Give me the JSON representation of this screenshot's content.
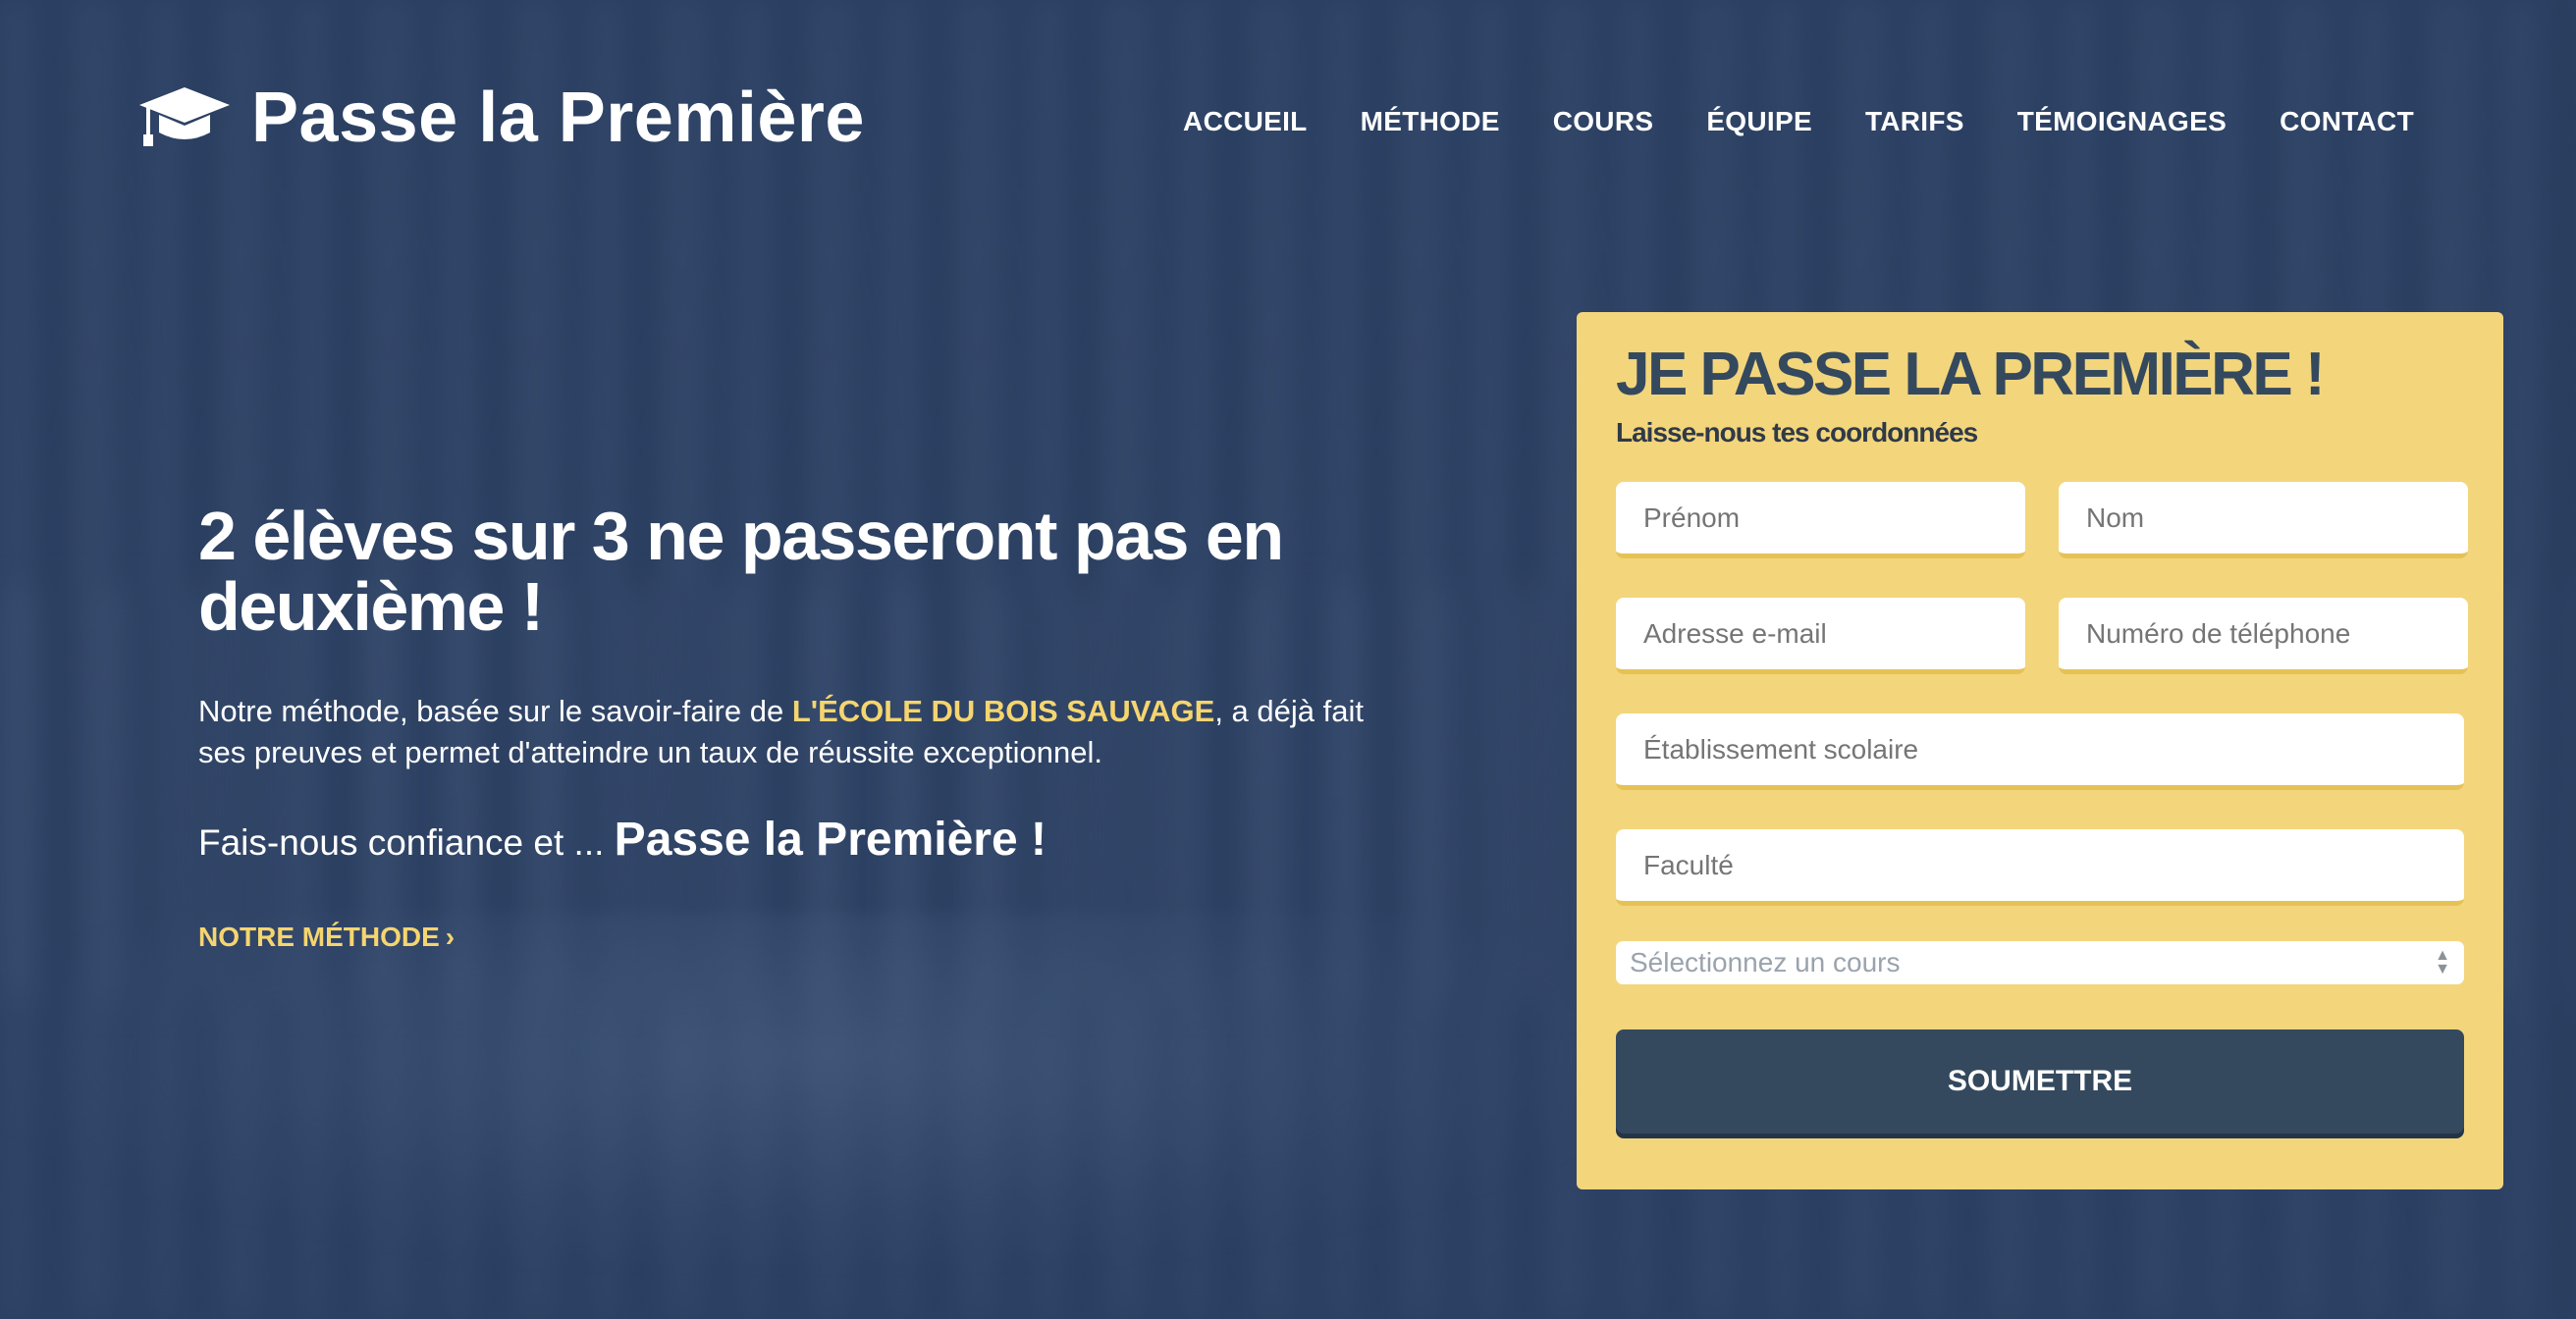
{
  "brand": {
    "name": "Passe la Première",
    "logo_icon": "graduation-cap-icon"
  },
  "nav": [
    {
      "label": "ACCUEIL"
    },
    {
      "label": "MÉTHODE"
    },
    {
      "label": "COURS"
    },
    {
      "label": "ÉQUIPE"
    },
    {
      "label": "TARIFS"
    },
    {
      "label": "TÉMOIGNAGES"
    },
    {
      "label": "CONTACT"
    }
  ],
  "hero": {
    "headline": "2 élèves sur 3 ne passeront pas en deuxième !",
    "desc_before": "Notre méthode, basée sur le savoir-faire de ",
    "desc_highlight": "L'ÉCOLE DU BOIS SAUVAGE",
    "desc_after": ", a déjà fait ses preuves et permet d'atteindre un taux de réussite exceptionnel.",
    "trust_before": "Fais-nous confiance et ... ",
    "trust_strong": "Passe la Première !",
    "cta_label": "NOTRE MÉTHODE",
    "cta_icon": "chevron-right-icon"
  },
  "form": {
    "title": "JE PASSE LA PREMIÈRE !",
    "subtitle": "Laisse-nous tes coordonnées",
    "first_name_placeholder": "Prénom",
    "last_name_placeholder": "Nom",
    "email_placeholder": "Adresse e-mail",
    "phone_placeholder": "Numéro de téléphone",
    "school_placeholder": "Établissement scolaire",
    "faculty_placeholder": "Faculté",
    "course_select": "Sélectionnez un cours",
    "submit_label": "SOUMETTRE"
  },
  "colors": {
    "accent_yellow": "#f5d56f",
    "card_yellow": "#f3d57c",
    "navy": "#34495e"
  }
}
